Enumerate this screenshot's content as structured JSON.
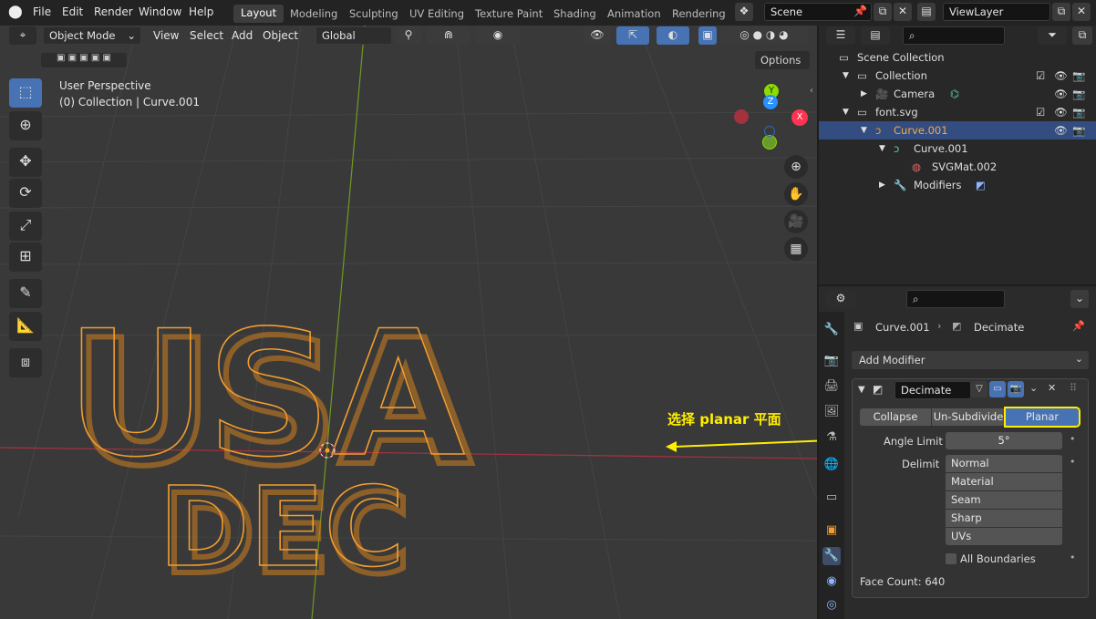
{
  "topbar": {
    "menus": [
      "File",
      "Edit",
      "Render",
      "Window",
      "Help"
    ],
    "workspaces": [
      "Layout",
      "Modeling",
      "Sculpting",
      "UV Editing",
      "Texture Paint",
      "Shading",
      "Animation",
      "Rendering"
    ],
    "active_workspace": "Layout",
    "scene": "Scene",
    "view_layer": "ViewLayer"
  },
  "viewport": {
    "mode": "Object Mode",
    "menus": [
      "View",
      "Select",
      "Add",
      "Object"
    ],
    "transform_orientation": "Global",
    "options_label": "Options",
    "perspective_label": "User Perspective",
    "context_label": "(0) Collection | Curve.001",
    "axis_x": "X",
    "axis_y": "Y",
    "axis_z": "Z",
    "text_line1": "USA",
    "text_line2": "DEC"
  },
  "annotation": {
    "text": "选择 planar 平面",
    "color": "#ffee00"
  },
  "outliner": {
    "items": [
      {
        "label": "Scene Collection"
      },
      {
        "label": "Collection"
      },
      {
        "label": "Camera"
      },
      {
        "label": "font.svg"
      },
      {
        "label": "Curve.001",
        "selected": true
      },
      {
        "label": "Curve.001"
      },
      {
        "label": "SVGMat.002"
      },
      {
        "label": "Modifiers"
      }
    ]
  },
  "properties": {
    "breadcrumb_object": "Curve.001",
    "breadcrumb_modifier": "Decimate",
    "add_modifier_label": "Add Modifier",
    "modifier_name": "Decimate",
    "modes": [
      "Collapse",
      "Un-Subdivide",
      "Planar"
    ],
    "active_mode": "Planar",
    "angle_limit_label": "Angle Limit",
    "angle_limit_value": "5°",
    "delimit_label": "Delimit",
    "delimit_options": [
      "Normal",
      "Material",
      "Seam",
      "Sharp",
      "UVs"
    ],
    "all_boundaries_label": "All Boundaries",
    "face_count": "Face Count: 640"
  },
  "colors": {
    "accent": "#4772b3",
    "selection": "#334d80",
    "object_outline": "#f29d2e",
    "x_axis": "#ff3352",
    "y_axis": "#8bdc00",
    "z_axis": "#2890ff"
  }
}
